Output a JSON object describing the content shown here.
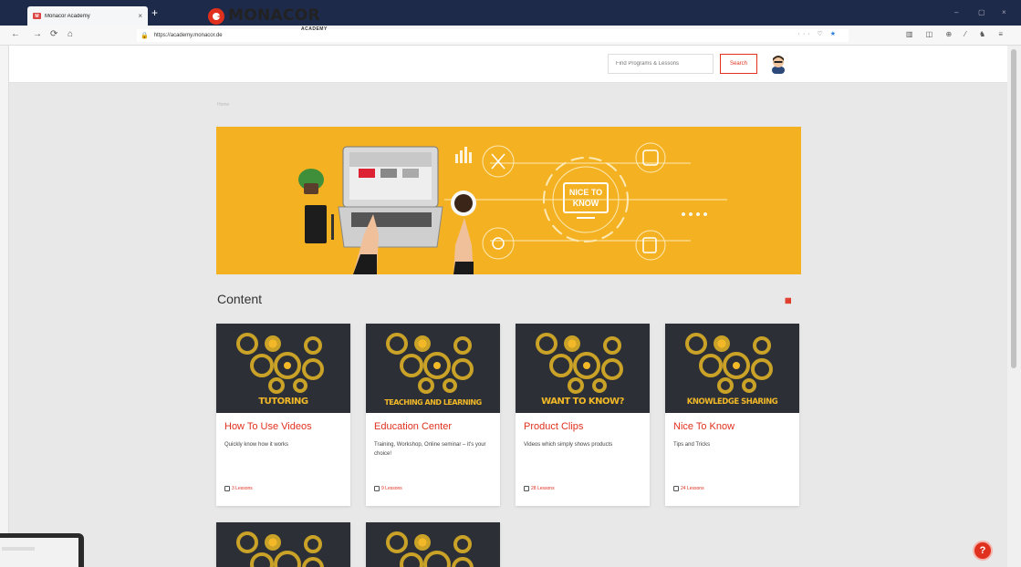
{
  "browser": {
    "tab_title": "Monacor Academy",
    "tab_close": "×",
    "new_tab": "+",
    "window_controls": {
      "minimize": "–",
      "restore": "▢",
      "close": "×"
    },
    "nav": {
      "back": "←",
      "forward": "→",
      "reload": "⟳",
      "home": "⌂"
    },
    "url": "https://academy.monacor.de",
    "url_actions": "··· ♡",
    "bookmark_star": "★",
    "toolbar_icons": "▥ ◫ ⊕ ⁄ ♞ ≡"
  },
  "site": {
    "logo_name": "MONACOR",
    "logo_sub": "ACADEMY",
    "search": {
      "placeholder": "Find Programs & Lessons",
      "button_label": "Search"
    },
    "breadcrumb": "Home",
    "hero_text": "NICE TO KNOW",
    "section_title": "Content",
    "grid_icon": "▦",
    "help_label": "?"
  },
  "cards": [
    {
      "banner": "TUTORING",
      "title": "How To Use Videos",
      "desc": "Quickly know how it works",
      "lessons": "3 Lessons"
    },
    {
      "banner": "TEACHING AND LEARNING",
      "title": "Education Center",
      "desc": "Training, Workshop, Online seminar – it's your choice!",
      "lessons": "9 Lessons"
    },
    {
      "banner": "WANT TO KNOW?",
      "title": "Product Clips",
      "desc": "Videos which simply shows products",
      "lessons": "28 Lessons"
    },
    {
      "banner": "KNOWLEDGE SHARING",
      "title": "Nice To Know",
      "desc": "Tips and Tricks",
      "lessons": "24 Lessons"
    }
  ],
  "colors": {
    "accent": "#e0301e",
    "hero": "#f4b223",
    "card_dark": "#2c3036",
    "gear": "#c9a227"
  }
}
